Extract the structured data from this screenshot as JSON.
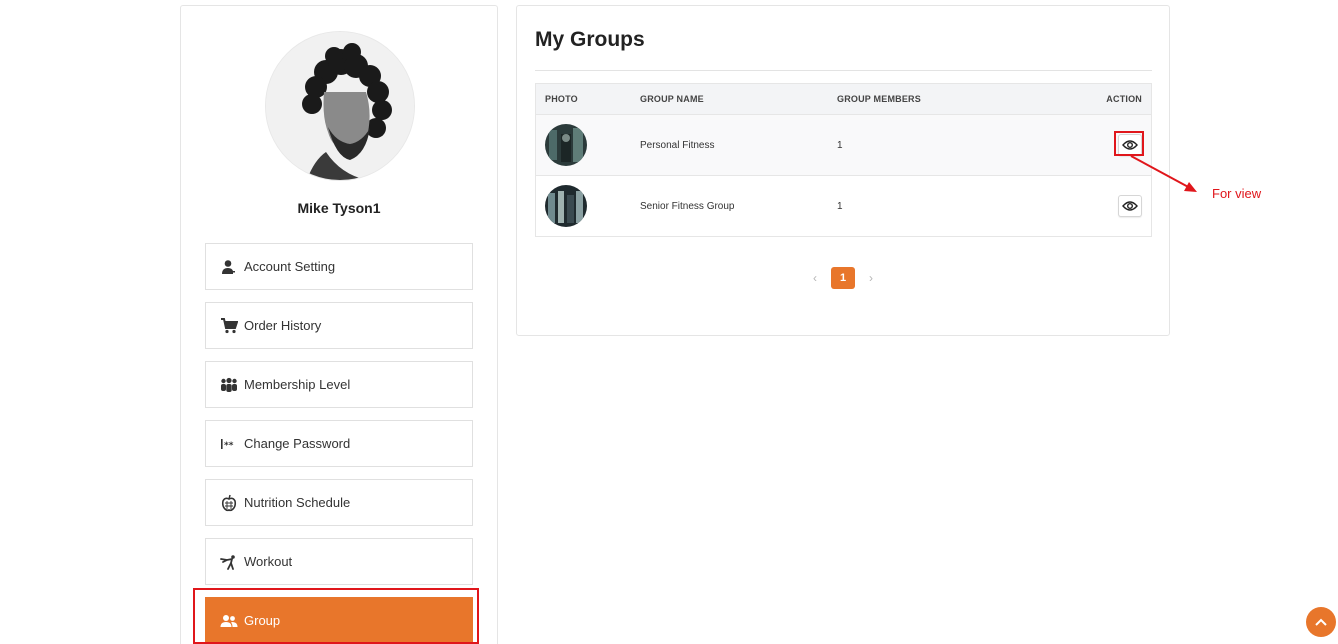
{
  "profile": {
    "name": "Mike Tyson1"
  },
  "sidebar": {
    "items": [
      {
        "label": "Account Setting",
        "icon": "user-icon"
      },
      {
        "label": "Order History",
        "icon": "cart-icon"
      },
      {
        "label": "Membership Level",
        "icon": "people-group-icon"
      },
      {
        "label": "Change Password",
        "icon": "password-icon"
      },
      {
        "label": "Nutrition Schedule",
        "icon": "apple-icon"
      },
      {
        "label": "Workout",
        "icon": "martial-arts-icon"
      },
      {
        "label": "Group",
        "icon": "users-icon",
        "active": true
      }
    ]
  },
  "main": {
    "title": "My Groups",
    "table": {
      "headers": {
        "photo": "PHOTO",
        "name": "GROUP NAME",
        "members": "GROUP MEMBERS",
        "action": "ACTION"
      },
      "rows": [
        {
          "name": "Personal Fitness",
          "members": "1"
        },
        {
          "name": "Senior Fitness Group",
          "members": "1"
        }
      ]
    },
    "pagination": {
      "prev": "‹",
      "current": "1",
      "next": "›"
    }
  },
  "annotation": {
    "text": "For view",
    "color": "#e0161b"
  },
  "colors": {
    "accent": "#e8762b"
  }
}
